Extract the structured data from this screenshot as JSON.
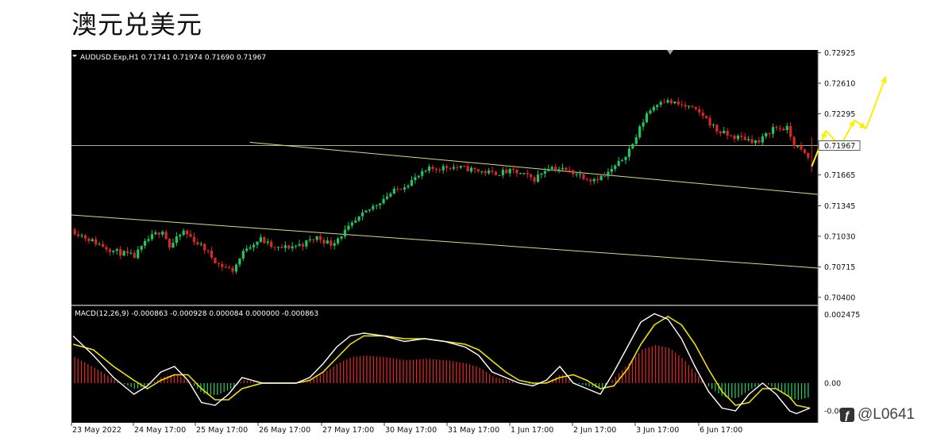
{
  "page": {
    "title": "澳元兑美元"
  },
  "watermark": {
    "text": "@L0641",
    "icon": "weibo-style-logo"
  },
  "chart_data": [
    {
      "type": "candlestick",
      "header": "AUDUSD.Exp,H1  0.71741 0.71974 0.71690 0.71967",
      "symbol": "AUDUSD.Exp",
      "timeframe": "H1",
      "ohlc_last": {
        "open": 0.71741,
        "high": 0.71974,
        "low": 0.7169,
        "close": 0.71967
      },
      "current_price_label": "0.71967",
      "y_ticks": [
        "0.72925",
        "0.72610",
        "0.72295",
        "0.71967",
        "0.71665",
        "0.71345",
        "0.71030",
        "0.70715",
        "0.70400"
      ],
      "ylim": [
        0.70325,
        0.72945
      ],
      "x_tick_labels": [
        "23 May 2022",
        "24 May 17:00",
        "25 May 17:00",
        "26 May 17:00",
        "27 May 17:00",
        "30 May 17:00",
        "31 May 17:00",
        "1 Jun 17:00",
        "2 Jun 17:00",
        "3 Jun 17:00",
        "6 Jun 17:00"
      ],
      "bar_count": 210,
      "colors": {
        "background": "#000000",
        "bull": "#22c55e",
        "bear": "#dc2626",
        "lines": "#d9d98a",
        "projection": "#ffee00",
        "current_price_line": "#c8c890"
      },
      "price_path": [
        [
          0,
          0.711
        ],
        [
          6,
          0.7098
        ],
        [
          12,
          0.7088
        ],
        [
          18,
          0.7082
        ],
        [
          22,
          0.71
        ],
        [
          26,
          0.711
        ],
        [
          28,
          0.7092
        ],
        [
          32,
          0.7108
        ],
        [
          38,
          0.709
        ],
        [
          42,
          0.7074
        ],
        [
          46,
          0.7068
        ],
        [
          50,
          0.7092
        ],
        [
          54,
          0.71
        ],
        [
          58,
          0.709
        ],
        [
          62,
          0.7092
        ],
        [
          66,
          0.7095
        ],
        [
          70,
          0.7102
        ],
        [
          74,
          0.7095
        ],
        [
          78,
          0.7108
        ],
        [
          84,
          0.7128
        ],
        [
          90,
          0.7145
        ],
        [
          96,
          0.7158
        ],
        [
          102,
          0.7172
        ],
        [
          108,
          0.7175
        ],
        [
          114,
          0.7172
        ],
        [
          120,
          0.7168
        ],
        [
          126,
          0.717
        ],
        [
          132,
          0.7162
        ],
        [
          136,
          0.7175
        ],
        [
          140,
          0.7172
        ],
        [
          144,
          0.7168
        ],
        [
          148,
          0.7162
        ],
        [
          152,
          0.7165
        ],
        [
          156,
          0.7178
        ],
        [
          160,
          0.7198
        ],
        [
          164,
          0.723
        ],
        [
          168,
          0.7244
        ],
        [
          172,
          0.724
        ],
        [
          176,
          0.7236
        ],
        [
          180,
          0.7228
        ],
        [
          184,
          0.7212
        ],
        [
          188,
          0.7206
        ],
        [
          192,
          0.7204
        ],
        [
          196,
          0.72
        ],
        [
          200,
          0.7215
        ],
        [
          204,
          0.7214
        ],
        [
          206,
          0.7198
        ],
        [
          210,
          0.7184
        ],
        [
          212,
          0.7172
        ],
        [
          214,
          0.7174
        ],
        [
          218,
          0.718
        ],
        [
          221,
          0.7192
        ],
        [
          222,
          0.7196
        ]
      ],
      "trendlines": [
        {
          "name": "upper",
          "from": [
            95,
            0.72
          ],
          "to": [
            400,
            0.7146
          ]
        },
        {
          "name": "lower",
          "from": [
            0,
            0.7125
          ],
          "to": [
            400,
            0.707
          ]
        }
      ],
      "horizontal_line": 0.71967,
      "projection_path": [
        [
          0,
          0.7175
        ],
        [
          5,
          0.7212
        ],
        [
          10,
          0.7196
        ],
        [
          15,
          0.7223
        ],
        [
          19,
          0.7214
        ],
        [
          26,
          0.7268
        ]
      ]
    },
    {
      "type": "line",
      "header": "MACD(12,26,9) -0.000863 -0.000928 0.000084 0.000000 -0.000863",
      "name": "MACD(12,26,9)",
      "values": {
        "macd": -0.000863,
        "signal": -0.000928,
        "histogram": 8.4e-05,
        "p4": 0.0,
        "p5": -0.000863
      },
      "y_ticks": [
        "0.002475",
        "0.00",
        "-0.001"
      ],
      "ylim": [
        -0.0014,
        0.0026
      ],
      "colors": {
        "macd": "#ffffff",
        "signal": "#f0e000",
        "hist_pos": "#dc2626",
        "hist_neg": "#22c55e"
      },
      "macd_path": [
        [
          0,
          0.0017
        ],
        [
          6,
          0.001
        ],
        [
          12,
          0.0002
        ],
        [
          18,
          -0.0004
        ],
        [
          22,
          -0.0001
        ],
        [
          26,
          0.0004
        ],
        [
          30,
          0.0006
        ],
        [
          34,
          0.0001
        ],
        [
          38,
          -0.0007
        ],
        [
          42,
          -0.0008
        ],
        [
          46,
          -0.0004
        ],
        [
          50,
          0.0002
        ],
        [
          56,
          0.0
        ],
        [
          62,
          0.0
        ],
        [
          66,
          0.0
        ],
        [
          70,
          0.0002
        ],
        [
          74,
          0.0007
        ],
        [
          78,
          0.0013
        ],
        [
          82,
          0.0017
        ],
        [
          86,
          0.0018
        ],
        [
          92,
          0.0017
        ],
        [
          98,
          0.0015
        ],
        [
          104,
          0.0016
        ],
        [
          110,
          0.0015
        ],
        [
          116,
          0.0013
        ],
        [
          120,
          0.001
        ],
        [
          124,
          0.0004
        ],
        [
          128,
          0.0002
        ],
        [
          132,
          0.0
        ],
        [
          136,
          -0.0001
        ],
        [
          140,
          0.0001
        ],
        [
          144,
          0.0006
        ],
        [
          148,
          0.0
        ],
        [
          152,
          -0.0002
        ],
        [
          156,
          -0.0004
        ],
        [
          160,
          0.0004
        ],
        [
          164,
          0.0013
        ],
        [
          168,
          0.0022
        ],
        [
          172,
          0.0025
        ],
        [
          176,
          0.0023
        ],
        [
          180,
          0.0016
        ],
        [
          184,
          0.0006
        ],
        [
          188,
          -0.0003
        ],
        [
          192,
          -0.0009
        ],
        [
          196,
          -0.001
        ],
        [
          200,
          -0.0004
        ],
        [
          204,
          0.0
        ],
        [
          208,
          -0.0004
        ],
        [
          212,
          -0.001
        ],
        [
          214,
          -0.0011
        ],
        [
          218,
          -0.0009
        ]
      ],
      "signal_path": [
        [
          0,
          0.0014
        ],
        [
          6,
          0.0012
        ],
        [
          12,
          0.0006
        ],
        [
          18,
          0.0001
        ],
        [
          22,
          -0.0002
        ],
        [
          26,
          0.0001
        ],
        [
          30,
          0.0003
        ],
        [
          34,
          0.0003
        ],
        [
          38,
          -0.0002
        ],
        [
          42,
          -0.0006
        ],
        [
          46,
          -0.0006
        ],
        [
          50,
          -0.0002
        ],
        [
          56,
          0.0
        ],
        [
          62,
          0.0
        ],
        [
          66,
          0.0
        ],
        [
          70,
          0.0001
        ],
        [
          74,
          0.0004
        ],
        [
          78,
          0.0009
        ],
        [
          82,
          0.0014
        ],
        [
          86,
          0.0017
        ],
        [
          92,
          0.0017
        ],
        [
          98,
          0.0016
        ],
        [
          104,
          0.0016
        ],
        [
          110,
          0.0015
        ],
        [
          116,
          0.0014
        ],
        [
          120,
          0.0012
        ],
        [
          124,
          0.0008
        ],
        [
          128,
          0.0004
        ],
        [
          132,
          0.0001
        ],
        [
          136,
          0.0
        ],
        [
          140,
          0.0
        ],
        [
          144,
          0.0002
        ],
        [
          148,
          0.0003
        ],
        [
          152,
          0.0001
        ],
        [
          156,
          -0.0002
        ],
        [
          160,
          -0.0001
        ],
        [
          164,
          0.0005
        ],
        [
          168,
          0.0014
        ],
        [
          172,
          0.0021
        ],
        [
          176,
          0.0024
        ],
        [
          180,
          0.0021
        ],
        [
          184,
          0.0014
        ],
        [
          188,
          0.0005
        ],
        [
          192,
          -0.0003
        ],
        [
          196,
          -0.0008
        ],
        [
          200,
          -0.0007
        ],
        [
          204,
          -0.0002
        ],
        [
          208,
          -0.0002
        ],
        [
          212,
          -0.0005
        ],
        [
          214,
          -0.0008
        ],
        [
          218,
          -0.0009
        ]
      ]
    }
  ]
}
